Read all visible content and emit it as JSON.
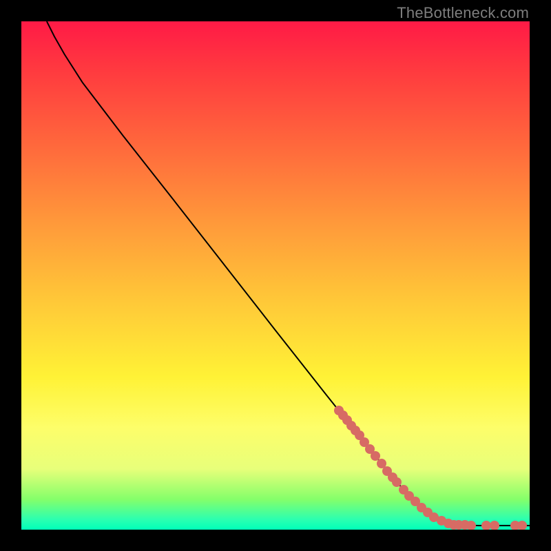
{
  "attribution": "TheBottleneck.com",
  "colors": {
    "frame_bg": "#000000",
    "curve": "#000000",
    "marker": "#d76b64",
    "attribution_text": "#7e7e7e"
  },
  "chart_data": {
    "type": "line",
    "title": "",
    "xlabel": "",
    "ylabel": "",
    "xlim": [
      0,
      100
    ],
    "ylim": [
      0,
      100
    ],
    "curve": [
      {
        "x": 5.0,
        "y": 100.0
      },
      {
        "x": 6.5,
        "y": 97.0
      },
      {
        "x": 8.5,
        "y": 93.5
      },
      {
        "x": 12.0,
        "y": 88.0
      },
      {
        "x": 20.0,
        "y": 77.5
      },
      {
        "x": 30.0,
        "y": 64.8
      },
      {
        "x": 40.0,
        "y": 52.0
      },
      {
        "x": 50.0,
        "y": 39.2
      },
      {
        "x": 60.0,
        "y": 26.5
      },
      {
        "x": 68.0,
        "y": 16.5
      },
      {
        "x": 74.0,
        "y": 9.2
      },
      {
        "x": 78.0,
        "y": 5.0
      },
      {
        "x": 81.0,
        "y": 2.6
      },
      {
        "x": 83.5,
        "y": 1.4
      },
      {
        "x": 86.0,
        "y": 0.9
      },
      {
        "x": 90.0,
        "y": 0.8
      },
      {
        "x": 95.0,
        "y": 0.8
      },
      {
        "x": 100.0,
        "y": 0.8
      }
    ],
    "markers": [
      {
        "x": 62.5,
        "y": 23.5
      },
      {
        "x": 63.3,
        "y": 22.5
      },
      {
        "x": 64.1,
        "y": 21.5
      },
      {
        "x": 64.9,
        "y": 20.5
      },
      {
        "x": 65.7,
        "y": 19.5
      },
      {
        "x": 66.5,
        "y": 18.5
      },
      {
        "x": 67.5,
        "y": 17.2
      },
      {
        "x": 68.5,
        "y": 15.9
      },
      {
        "x": 69.6,
        "y": 14.5
      },
      {
        "x": 70.8,
        "y": 13.0
      },
      {
        "x": 72.0,
        "y": 11.5
      },
      {
        "x": 73.0,
        "y": 10.3
      },
      {
        "x": 73.9,
        "y": 9.3
      },
      {
        "x": 75.2,
        "y": 7.9
      },
      {
        "x": 76.3,
        "y": 6.7
      },
      {
        "x": 77.5,
        "y": 5.5
      },
      {
        "x": 78.7,
        "y": 4.4
      },
      {
        "x": 79.9,
        "y": 3.4
      },
      {
        "x": 81.2,
        "y": 2.5
      },
      {
        "x": 82.6,
        "y": 1.8
      },
      {
        "x": 84.0,
        "y": 1.2
      },
      {
        "x": 85.1,
        "y": 1.0
      },
      {
        "x": 86.1,
        "y": 0.9
      },
      {
        "x": 87.2,
        "y": 0.9
      },
      {
        "x": 88.5,
        "y": 0.8
      },
      {
        "x": 91.4,
        "y": 0.8
      },
      {
        "x": 93.1,
        "y": 0.8
      },
      {
        "x": 97.2,
        "y": 0.8
      },
      {
        "x": 98.5,
        "y": 0.8
      }
    ]
  }
}
